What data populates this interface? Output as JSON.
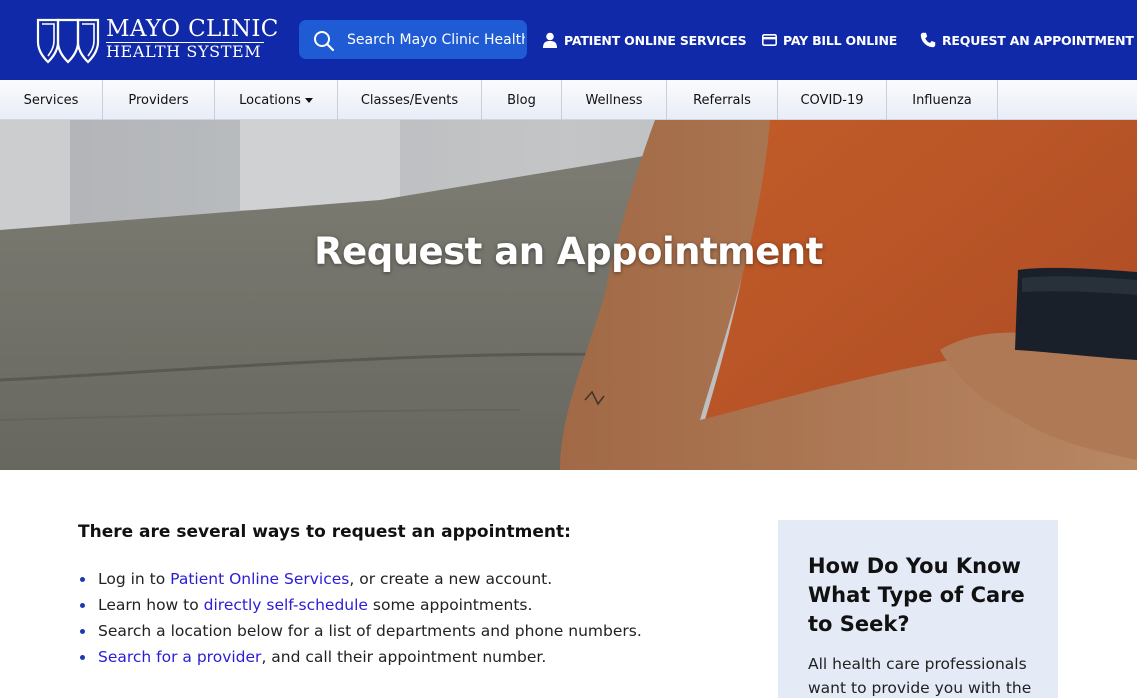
{
  "header": {
    "logo": {
      "line1": "MAYO CLINIC",
      "line2": "HEALTH SYSTEM"
    },
    "search": {
      "placeholder": "Search Mayo Clinic Health System"
    },
    "links": [
      {
        "label": "PATIENT ONLINE SERVICES",
        "icon": "person-icon"
      },
      {
        "label": "PAY BILL ONLINE",
        "icon": "credit-card-icon"
      },
      {
        "label": "REQUEST AN APPOINTMENT",
        "icon": "phone-icon"
      }
    ]
  },
  "nav": {
    "items": [
      {
        "label": "Services"
      },
      {
        "label": "Providers"
      },
      {
        "label": "Locations",
        "has_dropdown": true
      },
      {
        "label": "Classes/Events"
      },
      {
        "label": "Blog"
      },
      {
        "label": "Wellness"
      },
      {
        "label": "Referrals"
      },
      {
        "label": "COVID-19"
      },
      {
        "label": "Influenza"
      }
    ]
  },
  "hero": {
    "title": "Request an Appointment"
  },
  "main": {
    "intro": "There are several ways to request an appointment:",
    "ways": [
      {
        "before": "Log in to ",
        "link": "Patient Online Services",
        "after": ", or create a new account."
      },
      {
        "before": "Learn how to ",
        "link": "directly self-schedule",
        "after": " some appointments."
      },
      {
        "before": "Search a location below for a list of departments and phone numbers.",
        "link": "",
        "after": ""
      },
      {
        "before": "",
        "link": "Search for a provider",
        "after": ", and call their appointment number."
      }
    ]
  },
  "sidebar": {
    "heading": "How Do You Know What Type of Care to Seek?",
    "text": "All health care professionals want to provide you with the"
  },
  "colors": {
    "header_blue": "#0f29a8",
    "search_blue": "#1f5bd4",
    "link_purple": "#2a1dd6",
    "card_bg": "#e4ebf7"
  }
}
